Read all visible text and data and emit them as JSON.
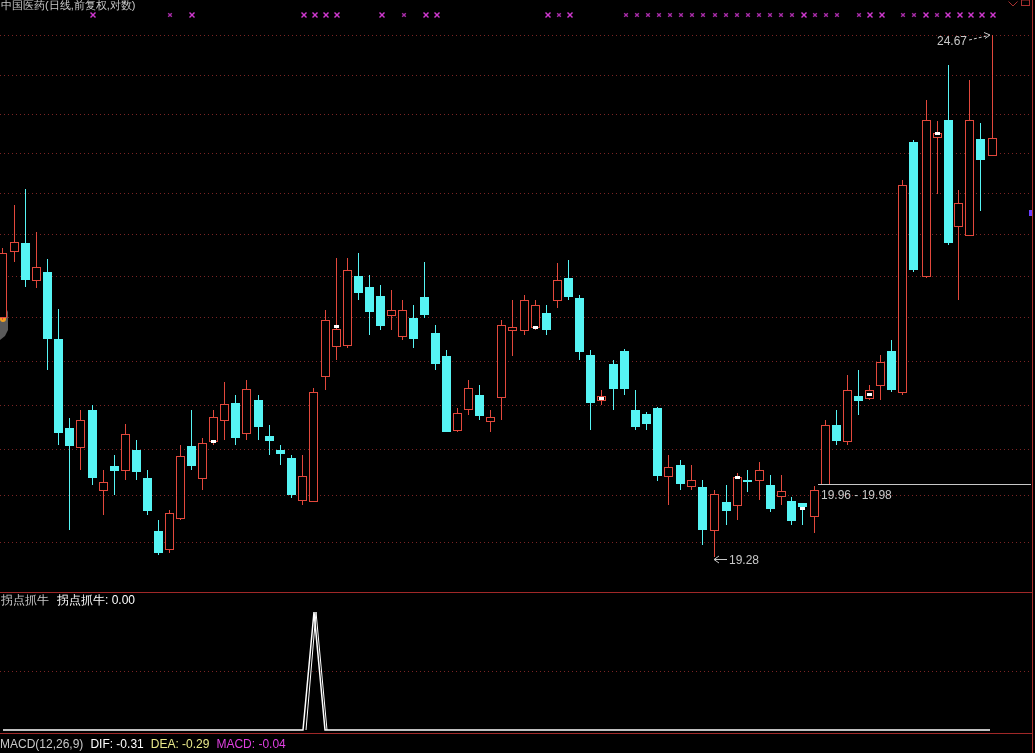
{
  "price_chart": {
    "title": "中国医药(日线,前复权,对数)",
    "annotations": [
      {
        "kind": "high",
        "text": "24.67"
      },
      {
        "kind": "range",
        "text": "19.96 - 19.98"
      },
      {
        "kind": "low",
        "text": "19.28"
      }
    ]
  },
  "indicator_panel": {
    "name": "拐点抓牛",
    "readout": "拐点抓牛: 0.00"
  },
  "macd_panel": {
    "readouts": [
      {
        "text": "MACD(12,26,9)",
        "color": "#c8c8c8"
      },
      {
        "text": "DIF: -0.31",
        "color": "#ffffff"
      },
      {
        "text": "DEA: -0.29",
        "color": "#e8e88a"
      },
      {
        "text": "MACD: -0.04",
        "color": "#e040e0"
      }
    ]
  }
}
